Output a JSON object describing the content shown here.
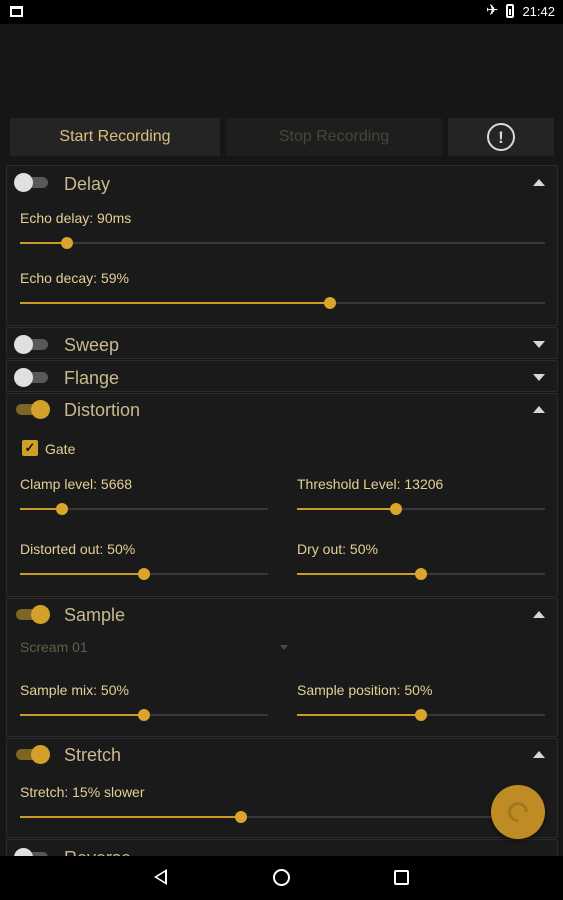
{
  "status_bar": {
    "time": "21:42"
  },
  "top_buttons": {
    "start_label": "Start Recording",
    "stop_label": "Stop Recording",
    "info_symbol": "!"
  },
  "effects": {
    "delay": {
      "title": "Delay",
      "enabled": false,
      "expanded": true,
      "echo_delay": {
        "label": "Echo delay: 90ms",
        "fraction": 0.09
      },
      "echo_decay": {
        "label": "Echo decay: 59%",
        "fraction": 0.59
      }
    },
    "sweep": {
      "title": "Sweep",
      "enabled": false,
      "expanded": false
    },
    "flange": {
      "title": "Flange",
      "enabled": false,
      "expanded": false
    },
    "distortion": {
      "title": "Distortion",
      "enabled": true,
      "expanded": true,
      "gate": {
        "label": "Gate",
        "checked": true
      },
      "clamp_level": {
        "label": "Clamp level: 5668",
        "fraction": 0.17
      },
      "threshold_level": {
        "label": "Threshold Level: 13206",
        "fraction": 0.4
      },
      "distorted_out": {
        "label": "Distorted out: 50%",
        "fraction": 0.5
      },
      "dry_out": {
        "label": "Dry out: 50%",
        "fraction": 0.5
      }
    },
    "sample": {
      "title": "Sample",
      "enabled": true,
      "expanded": true,
      "dropdown_value": "Scream 01",
      "sample_mix": {
        "label": "Sample mix: 50%",
        "fraction": 0.5
      },
      "sample_position": {
        "label": "Sample position: 50%",
        "fraction": 0.5
      }
    },
    "stretch": {
      "title": "Stretch",
      "enabled": true,
      "expanded": true,
      "stretch": {
        "label": "Stretch: 15% slower",
        "fraction": 0.42
      }
    },
    "reverse": {
      "title": "Reverse",
      "enabled": false
    }
  },
  "colors": {
    "accent": "#cb9b29",
    "background": "#161616",
    "panel": "#1a1a1a"
  },
  "icons": {
    "fab": "refresh-icon",
    "info": "exclamation-circle-icon"
  }
}
